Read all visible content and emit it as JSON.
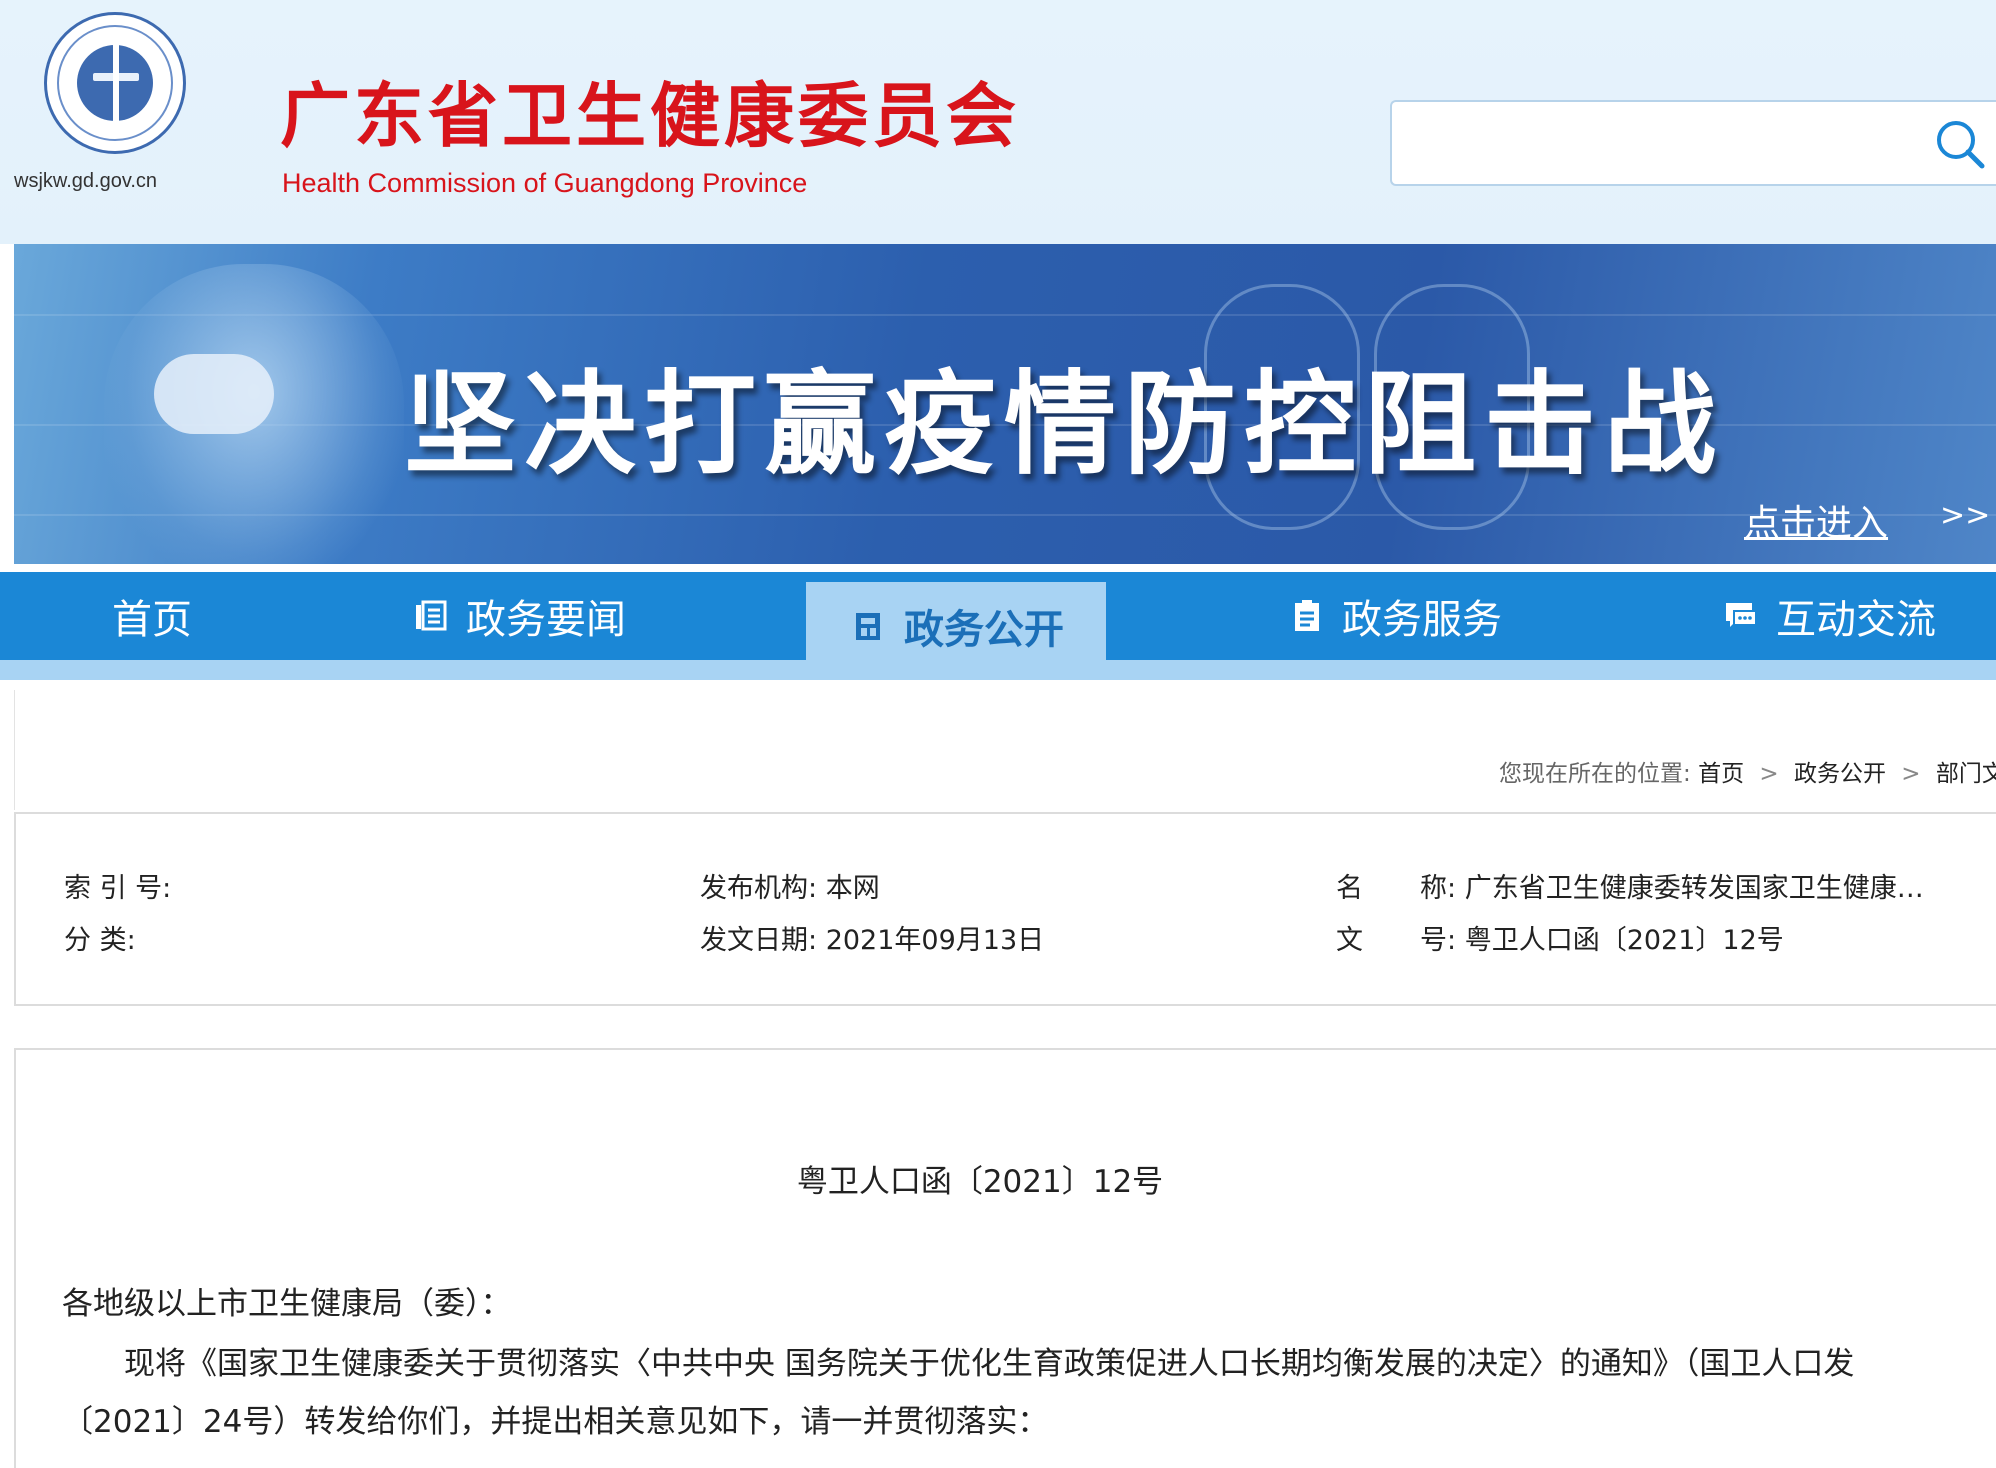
{
  "header": {
    "domain": "wsjkw.gd.gov.cn",
    "title": "广东省卫生健康委员会",
    "subtitle": "Health Commission of Guangdong Province",
    "search": {
      "placeholder": "",
      "value": ""
    }
  },
  "banner": {
    "title": "坚决打赢疫情防控阻击战",
    "link_label": "点击进入",
    "arrow": ">>"
  },
  "nav": {
    "items": [
      {
        "label": "首页",
        "icon": ""
      },
      {
        "label": "政务要闻",
        "icon": "news-icon"
      },
      {
        "label": "政务公开",
        "icon": "document-icon",
        "active": true
      },
      {
        "label": "政务服务",
        "icon": "clipboard-icon"
      },
      {
        "label": "互动交流",
        "icon": "chat-icon"
      }
    ]
  },
  "breadcrumb": {
    "prefix": "您现在所在的位置:",
    "items": [
      "首页",
      "政务公开",
      "部门文件"
    ],
    "separator": ">"
  },
  "meta": {
    "index_no_label": "索 引 号:",
    "index_no_value": "",
    "category_label": "分  类:",
    "category_value": "",
    "publisher_label": "发布机构:",
    "publisher_value": "本网",
    "date_label": "发文日期:",
    "date_value": "2021年09月13日",
    "name_label_1": "名",
    "name_label_2": "称:",
    "name_value": "广东省卫生健康委转发国家卫生健康…",
    "doc_no_label_1": "文",
    "doc_no_label_2": "号:",
    "doc_no_value": "粤卫人口函〔2021〕12号"
  },
  "document": {
    "number": "粤卫人口函〔2021〕12号",
    "salutation": "各地级以上市卫生健康局（委）：",
    "paragraph_line1": "现将《国家卫生健康委关于贯彻落实〈中共中央 国务院关于优化生育政策促进人口长期均衡发展的决定〉的通知》（国卫人口发",
    "paragraph_line2": "〔2021〕24号）转发给你们，并提出相关意见如下，请一并贯彻落实："
  },
  "colors": {
    "brand_red": "#d8141b",
    "nav_blue": "#1b87d6",
    "nav_active_bg": "#a8d3f3",
    "header_bg": "#e6f3fc"
  }
}
